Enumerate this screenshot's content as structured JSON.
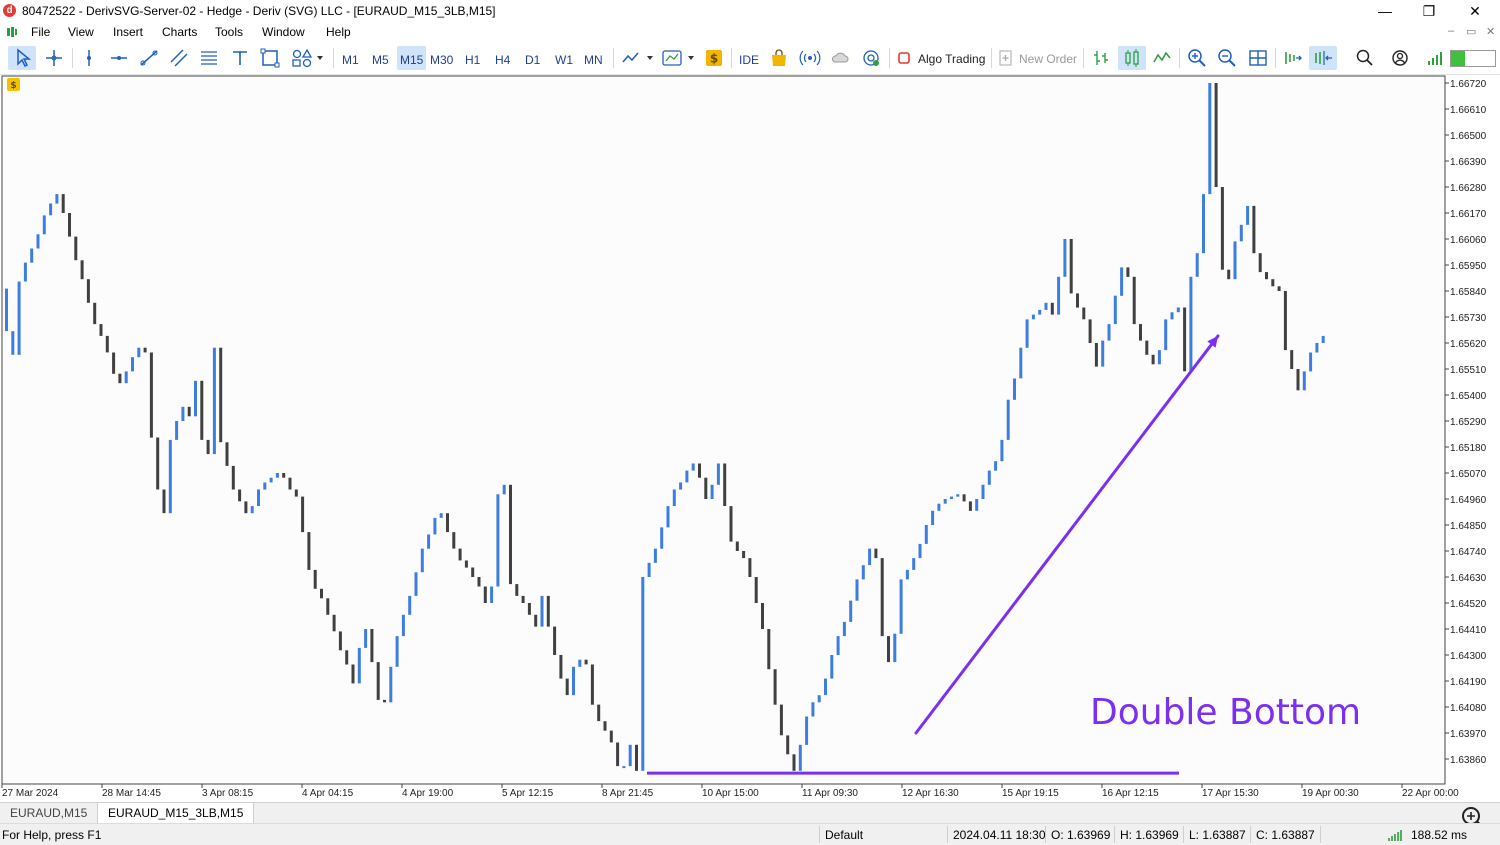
{
  "window": {
    "title": "80472522 - DerivSVG-Server-02 - Hedge - Deriv (SVG) LLC - [EURAUD_M15_3LB,M15]",
    "minimize": "—",
    "maximize": "❐",
    "close": "✕"
  },
  "menu": {
    "items": [
      "File",
      "View",
      "Insert",
      "Charts",
      "Tools",
      "Window",
      "Help"
    ],
    "mdi_min": "–",
    "mdi_restore": "▭",
    "mdi_close": "✕"
  },
  "toolbar": {
    "timeframes": [
      "M1",
      "M5",
      "M15",
      "M30",
      "H1",
      "H4",
      "D1",
      "W1",
      "MN"
    ],
    "active_timeframe": "M15",
    "ide_label": "IDE",
    "algo_trading_label": "Algo Trading",
    "new_order_label": "New Order"
  },
  "chart": {
    "annotation": "Double Bottom",
    "annotation_color": "#7b2ff0",
    "bull_color": "#3d7de0",
    "bear_color": "#404040",
    "price_labels": [
      "1.66720",
      "1.66610",
      "1.66500",
      "1.66390",
      "1.66280",
      "1.66170",
      "1.66060",
      "1.65950",
      "1.65840",
      "1.65730",
      "1.65620",
      "1.65510",
      "1.65400",
      "1.65290",
      "1.65180",
      "1.65070",
      "1.64960",
      "1.64850",
      "1.64740",
      "1.64630",
      "1.64520",
      "1.64410",
      "1.64300",
      "1.64190",
      "1.64080",
      "1.63970",
      "1.63860"
    ],
    "time_labels": [
      "27 Mar 2024",
      "28 Mar 14:45",
      "3 Apr 08:15",
      "4 Apr 04:15",
      "4 Apr 19:00",
      "5 Apr 12:15",
      "8 Apr 21:45",
      "10 Apr 15:00",
      "11 Apr 09:30",
      "12 Apr 16:30",
      "15 Apr 19:15",
      "16 Apr 12:15",
      "17 Apr 15:30",
      "19 Apr 00:30",
      "22 Apr 00:00"
    ]
  },
  "chart_data": {
    "type": "bar",
    "title": "",
    "symbol": "EURAUD_M15_3LB,M15",
    "xlabel": "",
    "ylabel": "",
    "ylim": [
      1.638,
      1.668
    ],
    "bricks": [
      [
        1.6567,
        1.6585
      ],
      [
        1.6557,
        1.6567
      ],
      [
        1.6557,
        1.6588
      ],
      [
        1.6588,
        1.6596
      ],
      [
        1.6596,
        1.6602
      ],
      [
        1.6602,
        1.6608
      ],
      [
        1.6608,
        1.6616
      ],
      [
        1.6616,
        1.6621
      ],
      [
        1.6621,
        1.6625
      ],
      [
        1.6625,
        1.6617
      ],
      [
        1.6617,
        1.6607
      ],
      [
        1.6607,
        1.6597
      ],
      [
        1.6597,
        1.6589
      ],
      [
        1.6589,
        1.6579
      ],
      [
        1.6579,
        1.657
      ],
      [
        1.657,
        1.6565
      ],
      [
        1.6565,
        1.6558
      ],
      [
        1.6558,
        1.6549
      ],
      [
        1.6549,
        1.6545
      ],
      [
        1.6545,
        1.655
      ],
      [
        1.655,
        1.6556
      ],
      [
        1.6556,
        1.656
      ],
      [
        1.656,
        1.6558
      ],
      [
        1.6558,
        1.6522
      ],
      [
        1.6522,
        1.65
      ],
      [
        1.65,
        1.649
      ],
      [
        1.649,
        1.6521
      ],
      [
        1.6521,
        1.6529
      ],
      [
        1.6529,
        1.6535
      ],
      [
        1.6535,
        1.6531
      ],
      [
        1.6531,
        1.6546
      ],
      [
        1.6546,
        1.6521
      ],
      [
        1.6521,
        1.6515
      ],
      [
        1.6515,
        1.656
      ],
      [
        1.656,
        1.652
      ],
      [
        1.652,
        1.651
      ],
      [
        1.651,
        1.65
      ],
      [
        1.65,
        1.6495
      ],
      [
        1.6495,
        1.649
      ],
      [
        1.649,
        1.6493
      ],
      [
        1.6493,
        1.65
      ],
      [
        1.65,
        1.6503
      ],
      [
        1.6503,
        1.6505
      ],
      [
        1.6505,
        1.6507
      ],
      [
        1.6507,
        1.6505
      ],
      [
        1.6505,
        1.65
      ],
      [
        1.65,
        1.6497
      ],
      [
        1.6497,
        1.6482
      ],
      [
        1.6482,
        1.6466
      ],
      [
        1.6466,
        1.6458
      ],
      [
        1.6458,
        1.6454
      ],
      [
        1.6454,
        1.6447
      ],
      [
        1.6447,
        1.644
      ],
      [
        1.644,
        1.6432
      ],
      [
        1.6432,
        1.6426
      ],
      [
        1.6426,
        1.6418
      ],
      [
        1.6418,
        1.6433
      ],
      [
        1.6433,
        1.6441
      ],
      [
        1.6441,
        1.6427
      ],
      [
        1.6427,
        1.6411
      ],
      [
        1.6411,
        1.641
      ],
      [
        1.641,
        1.6425
      ],
      [
        1.6425,
        1.6438
      ],
      [
        1.6438,
        1.6447
      ],
      [
        1.6447,
        1.6455
      ],
      [
        1.6455,
        1.6465
      ],
      [
        1.6465,
        1.6475
      ],
      [
        1.6475,
        1.6481
      ],
      [
        1.6481,
        1.6488
      ],
      [
        1.6488,
        1.649
      ],
      [
        1.649,
        1.6482
      ],
      [
        1.6482,
        1.6475
      ],
      [
        1.6475,
        1.647
      ],
      [
        1.647,
        1.6467
      ],
      [
        1.6467,
        1.6463
      ],
      [
        1.6463,
        1.6459
      ],
      [
        1.6459,
        1.6452
      ],
      [
        1.6452,
        1.6459
      ],
      [
        1.6459,
        1.6498
      ],
      [
        1.6498,
        1.6502
      ],
      [
        1.6502,
        1.646
      ],
      [
        1.646,
        1.6455
      ],
      [
        1.6455,
        1.6452
      ],
      [
        1.6452,
        1.6447
      ],
      [
        1.6447,
        1.6442
      ],
      [
        1.6442,
        1.6455
      ],
      [
        1.6455,
        1.6442
      ],
      [
        1.6442,
        1.643
      ],
      [
        1.643,
        1.642
      ],
      [
        1.642,
        1.6413
      ],
      [
        1.6413,
        1.6425
      ],
      [
        1.6425,
        1.6428
      ],
      [
        1.6428,
        1.6426
      ],
      [
        1.6426,
        1.6409
      ],
      [
        1.6409,
        1.6402
      ],
      [
        1.6402,
        1.6398
      ],
      [
        1.6398,
        1.6393
      ],
      [
        1.6393,
        1.6383
      ],
      [
        1.6383,
        1.6383
      ],
      [
        1.6383,
        1.6392
      ],
      [
        1.6392,
        1.6381
      ],
      [
        1.6381,
        1.6463
      ],
      [
        1.6463,
        1.6469
      ],
      [
        1.6469,
        1.6475
      ],
      [
        1.6475,
        1.6484
      ],
      [
        1.6484,
        1.6493
      ],
      [
        1.6493,
        1.65
      ],
      [
        1.65,
        1.6503
      ],
      [
        1.6503,
        1.6508
      ],
      [
        1.6508,
        1.6511
      ],
      [
        1.6511,
        1.6505
      ],
      [
        1.6505,
        1.6496
      ],
      [
        1.6496,
        1.6502
      ],
      [
        1.6502,
        1.6511
      ],
      [
        1.6511,
        1.6493
      ],
      [
        1.6493,
        1.6478
      ],
      [
        1.6478,
        1.6474
      ],
      [
        1.6474,
        1.6471
      ],
      [
        1.6471,
        1.6463
      ],
      [
        1.6463,
        1.6452
      ],
      [
        1.6452,
        1.6441
      ],
      [
        1.6441,
        1.6424
      ],
      [
        1.6424,
        1.6409
      ],
      [
        1.6409,
        1.6396
      ],
      [
        1.6396,
        1.6388
      ],
      [
        1.6388,
        1.6381
      ],
      [
        1.6381,
        1.6392
      ],
      [
        1.6392,
        1.6404
      ],
      [
        1.6404,
        1.641
      ],
      [
        1.641,
        1.6413
      ],
      [
        1.6413,
        1.642
      ],
      [
        1.642,
        1.643
      ],
      [
        1.643,
        1.6438
      ],
      [
        1.6438,
        1.6444
      ],
      [
        1.6444,
        1.6453
      ],
      [
        1.6453,
        1.6462
      ],
      [
        1.6462,
        1.6468
      ],
      [
        1.6468,
        1.6475
      ],
      [
        1.6475,
        1.6471
      ],
      [
        1.6471,
        1.6438
      ],
      [
        1.6438,
        1.6427
      ],
      [
        1.6427,
        1.6439
      ],
      [
        1.6439,
        1.6462
      ],
      [
        1.6462,
        1.6466
      ],
      [
        1.6466,
        1.6471
      ],
      [
        1.6471,
        1.6477
      ],
      [
        1.6477,
        1.6485
      ],
      [
        1.6485,
        1.6491
      ],
      [
        1.6491,
        1.6494
      ],
      [
        1.6494,
        1.6496
      ],
      [
        1.6496,
        1.6497
      ],
      [
        1.6497,
        1.6498
      ],
      [
        1.6498,
        1.6495
      ],
      [
        1.6495,
        1.6491
      ],
      [
        1.6491,
        1.6496
      ],
      [
        1.6496,
        1.6502
      ],
      [
        1.6502,
        1.6508
      ],
      [
        1.6508,
        1.6512
      ],
      [
        1.6512,
        1.6521
      ],
      [
        1.6521,
        1.6538
      ],
      [
        1.6538,
        1.6547
      ],
      [
        1.6547,
        1.656
      ],
      [
        1.656,
        1.6572
      ],
      [
        1.6572,
        1.6574
      ],
      [
        1.6574,
        1.6576
      ],
      [
        1.6576,
        1.6579
      ],
      [
        1.6579,
        1.6574
      ],
      [
        1.6574,
        1.659
      ],
      [
        1.659,
        1.6606
      ],
      [
        1.6606,
        1.6583
      ],
      [
        1.6583,
        1.6577
      ],
      [
        1.6577,
        1.6572
      ],
      [
        1.6572,
        1.6562
      ],
      [
        1.6562,
        1.6552
      ],
      [
        1.6552,
        1.6563
      ],
      [
        1.6563,
        1.657
      ],
      [
        1.657,
        1.6582
      ],
      [
        1.6582,
        1.6594
      ],
      [
        1.6594,
        1.659
      ],
      [
        1.659,
        1.657
      ],
      [
        1.657,
        1.6563
      ],
      [
        1.6563,
        1.6557
      ],
      [
        1.6557,
        1.6553
      ],
      [
        1.6553,
        1.6559
      ],
      [
        1.6559,
        1.6572
      ],
      [
        1.6572,
        1.6575
      ],
      [
        1.6575,
        1.6577
      ],
      [
        1.6577,
        1.655
      ],
      [
        1.655,
        1.659
      ],
      [
        1.659,
        1.66
      ],
      [
        1.66,
        1.6625
      ],
      [
        1.6625,
        1.6672
      ],
      [
        1.6672,
        1.6628
      ],
      [
        1.6628,
        1.6593
      ],
      [
        1.6593,
        1.6589
      ],
      [
        1.6589,
        1.6605
      ],
      [
        1.6605,
        1.6612
      ],
      [
        1.6612,
        1.662
      ],
      [
        1.662,
        1.66
      ],
      [
        1.66,
        1.6592
      ],
      [
        1.6592,
        1.6589
      ],
      [
        1.6589,
        1.6586
      ],
      [
        1.6586,
        1.6584
      ],
      [
        1.6584,
        1.6559
      ],
      [
        1.6559,
        1.6551
      ],
      [
        1.6551,
        1.6542
      ],
      [
        1.6542,
        1.655
      ],
      [
        1.655,
        1.6558
      ],
      [
        1.6558,
        1.6562
      ],
      [
        1.6562,
        1.6565
      ]
    ],
    "support_line": {
      "price": 1.638,
      "from": "8 Apr 21:45",
      "to": "17 Apr 15:30"
    },
    "arrow": {
      "from": [
        1.6397,
        "12 Apr 16:30"
      ],
      "to": [
        1.6565,
        "17 Apr 15:30"
      ]
    }
  },
  "tabs": [
    "EURAUD,M15",
    "EURAUD_M15_3LB,M15"
  ],
  "active_tab": "EURAUD_M15_3LB,M15",
  "status": {
    "help": "For Help, press F1",
    "profile": "Default",
    "datetime": "2024.04.11 18:30",
    "open": "O: 1.63969",
    "high": "H: 1.63969",
    "low": "L: 1.63887",
    "close": "C: 1.63887",
    "ping": "188.52 ms"
  }
}
